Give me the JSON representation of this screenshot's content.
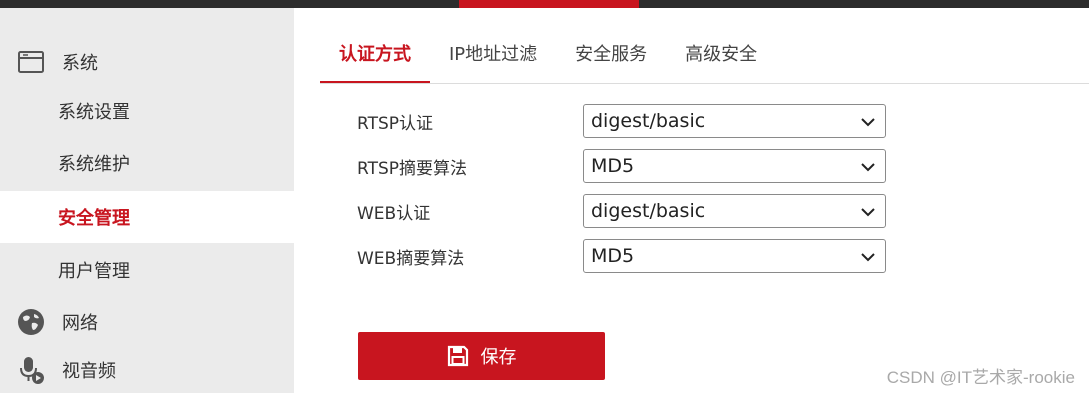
{
  "sidebar": {
    "items": [
      {
        "label": "系统",
        "icon": "window-icon",
        "kind": "group"
      },
      {
        "label": "系统设置",
        "kind": "sub"
      },
      {
        "label": "系统维护",
        "kind": "sub"
      },
      {
        "label": "安全管理",
        "kind": "sub",
        "active": true
      },
      {
        "label": "用户管理",
        "kind": "sub"
      },
      {
        "label": "网络",
        "icon": "globe-icon",
        "kind": "group"
      },
      {
        "label": "视音频",
        "icon": "microphone-icon",
        "kind": "group"
      }
    ]
  },
  "tabs": [
    {
      "label": "认证方式",
      "active": true
    },
    {
      "label": "IP地址过滤"
    },
    {
      "label": "安全服务"
    },
    {
      "label": "高级安全"
    }
  ],
  "form": {
    "rows": [
      {
        "label": "RTSP认证",
        "value": "digest/basic"
      },
      {
        "label": "RTSP摘要算法",
        "value": "MD5"
      },
      {
        "label": "WEB认证",
        "value": "digest/basic"
      },
      {
        "label": "WEB摘要算法",
        "value": "MD5"
      }
    ]
  },
  "save_button": {
    "label": "保存",
    "icon": "save-icon"
  },
  "watermark": "CSDN @IT艺术家-rookie",
  "colors": {
    "accent": "#c8151f",
    "topbar": "#2c2c2c",
    "sidebar_bg": "#ebebeb"
  }
}
